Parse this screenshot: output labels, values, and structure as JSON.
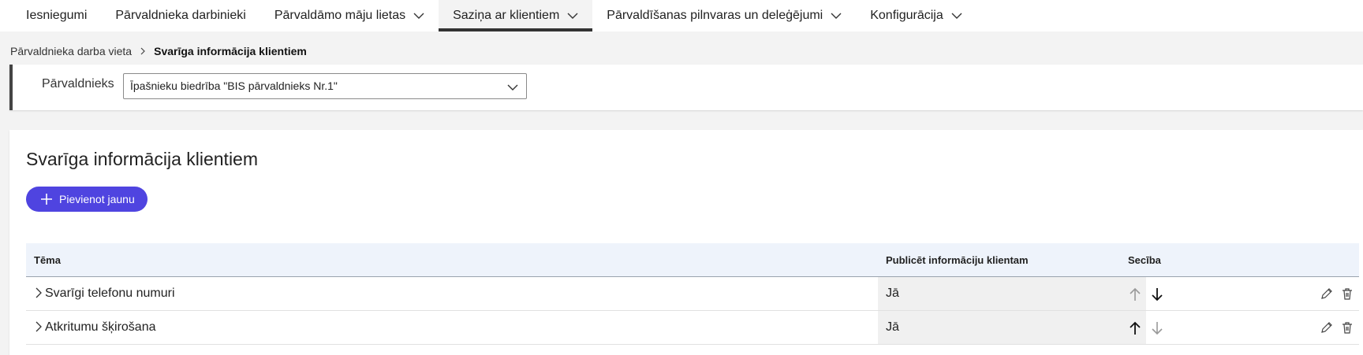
{
  "nav": {
    "items": [
      {
        "label": "Iesniegumi"
      },
      {
        "label": "Pārvaldnieka darbinieki"
      },
      {
        "label": "Pārvaldāmo māju lietas"
      },
      {
        "label": "Saziņa ar klientiem"
      },
      {
        "label": "Pārvaldīšanas pilnvaras un deleģējumi"
      },
      {
        "label": "Konfigurācija"
      }
    ]
  },
  "breadcrumb": {
    "parent": "Pārvaldnieka darba vieta",
    "current": "Svarīga informācija klientiem"
  },
  "filter": {
    "label": "Pārvaldnieks",
    "selected": "Īpašnieku biedrība \"BIS pārvaldnieks Nr.1\""
  },
  "main": {
    "title": "Svarīga informācija klientiem",
    "add_button": "Pievienot jaunu"
  },
  "table": {
    "columns": {
      "topic": "Tēma",
      "publish": "Publicēt informāciju klientam",
      "order": "Secība"
    },
    "rows": [
      {
        "topic": "Svarīgi telefonu numuri",
        "publish": "Jā"
      },
      {
        "topic": "Atkritumu šķirošana",
        "publish": "Jā"
      }
    ]
  },
  "colors": {
    "accent": "#4f44e0",
    "active_tab_bar": "#333333",
    "table_header_bg": "#eef3fb"
  }
}
